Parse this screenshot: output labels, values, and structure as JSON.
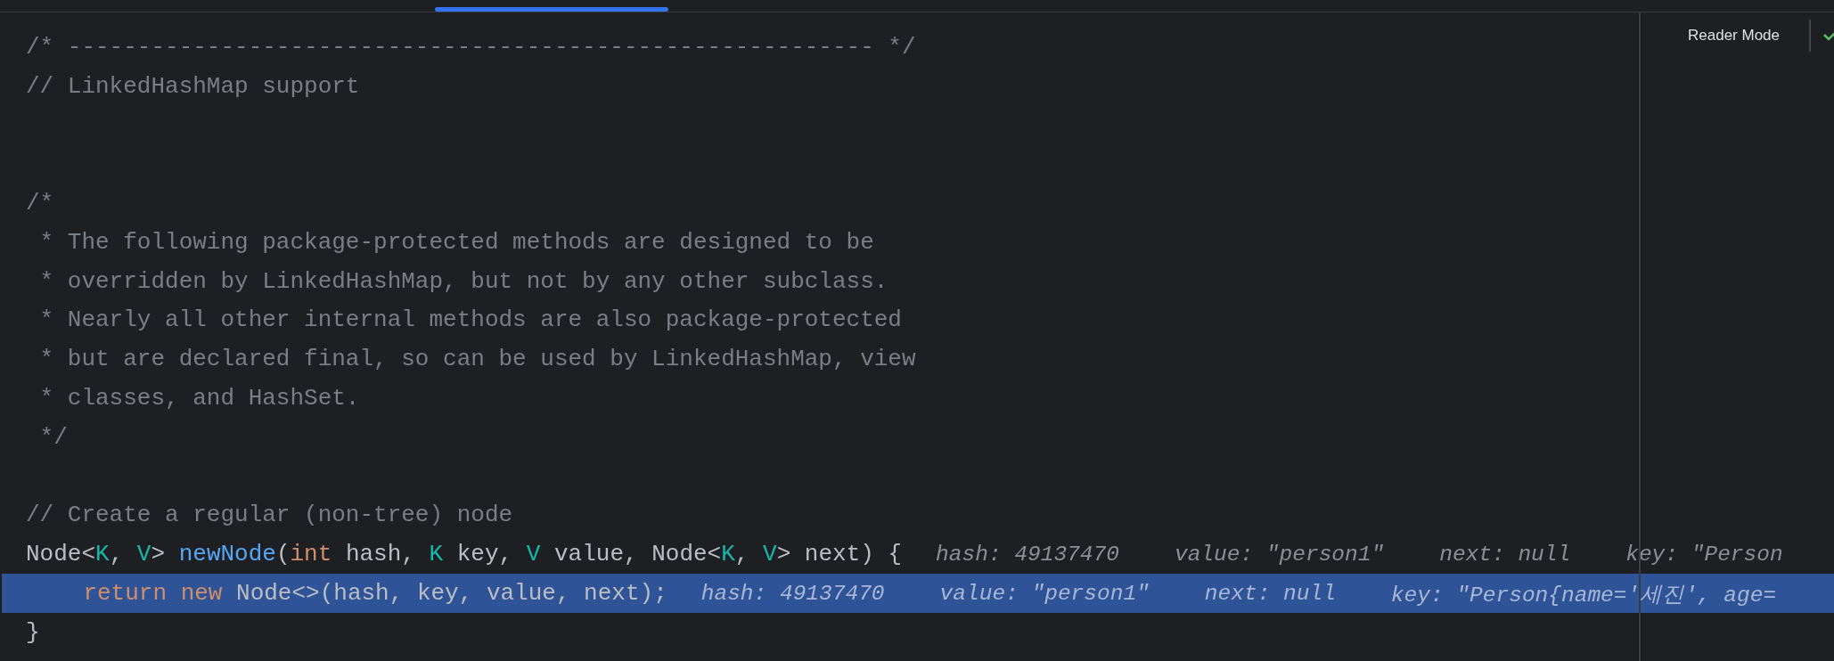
{
  "editor": {
    "reader_mode": {
      "label": "Reader Mode"
    },
    "lines": [
      {
        "current": false,
        "tokens": [
          {
            "kind": "comment",
            "text": "/* ---------------------------------------------------------- */"
          }
        ]
      },
      {
        "current": false,
        "tokens": [
          {
            "kind": "comment",
            "text": "// LinkedHashMap support"
          }
        ]
      },
      {
        "current": false
      },
      {
        "current": false
      },
      {
        "current": false,
        "tokens": [
          {
            "kind": "comment",
            "text": "/*"
          }
        ]
      },
      {
        "current": false,
        "tokens": [
          {
            "kind": "comment",
            "text": " * The following package-protected methods are designed to be"
          }
        ]
      },
      {
        "current": false,
        "tokens": [
          {
            "kind": "comment",
            "text": " * overridden by LinkedHashMap, but not by any other subclass."
          }
        ]
      },
      {
        "current": false,
        "tokens": [
          {
            "kind": "comment",
            "text": " * Nearly all other internal methods are also package-protected"
          }
        ]
      },
      {
        "current": false,
        "tokens": [
          {
            "kind": "comment",
            "text": " * but are declared final, so can be used by LinkedHashMap, view"
          }
        ]
      },
      {
        "current": false,
        "tokens": [
          {
            "kind": "comment",
            "text": " * classes, and HashSet."
          }
        ]
      },
      {
        "current": false,
        "tokens": [
          {
            "kind": "comment",
            "text": " */"
          }
        ]
      },
      {
        "current": false
      },
      {
        "current": false,
        "tokens": [
          {
            "kind": "comment",
            "text": "// Create a regular (non-tree) node"
          }
        ]
      },
      {
        "current": false,
        "tokens": [
          {
            "kind": "plain",
            "text": "Node<"
          },
          {
            "kind": "typeparam",
            "text": "K"
          },
          {
            "kind": "plain",
            "text": ", "
          },
          {
            "kind": "typeparam",
            "text": "V"
          },
          {
            "kind": "plain",
            "text": "> "
          },
          {
            "kind": "method",
            "text": "newNode"
          },
          {
            "kind": "plain",
            "text": "("
          },
          {
            "kind": "keyword",
            "text": "int"
          },
          {
            "kind": "plain",
            "text": " hash, "
          },
          {
            "kind": "typeparam",
            "text": "K"
          },
          {
            "kind": "plain",
            "text": " key, "
          },
          {
            "kind": "typeparam",
            "text": "V"
          },
          {
            "kind": "plain",
            "text": " value, Node<"
          },
          {
            "kind": "typeparam",
            "text": "K"
          },
          {
            "kind": "plain",
            "text": ", "
          },
          {
            "kind": "typeparam",
            "text": "V"
          },
          {
            "kind": "plain",
            "text": "> next) {"
          }
        ],
        "hints": [
          "hash: 49137470",
          "value: \"person1\"",
          "next: null",
          "key: \"Person"
        ]
      },
      {
        "current": true,
        "tokens": [
          {
            "kind": "keyword",
            "text": "    return"
          },
          {
            "kind": "keyword",
            "text": " new"
          },
          {
            "kind": "plain",
            "text": " Node<>(hash, key, value, next);"
          }
        ],
        "hints": [
          "hash: 49137470",
          "value: \"person1\"",
          "next: null",
          "key: \"Person{name='세진', age="
        ]
      },
      {
        "current": false,
        "tokens": [
          {
            "kind": "plain",
            "text": "}"
          }
        ]
      }
    ]
  }
}
